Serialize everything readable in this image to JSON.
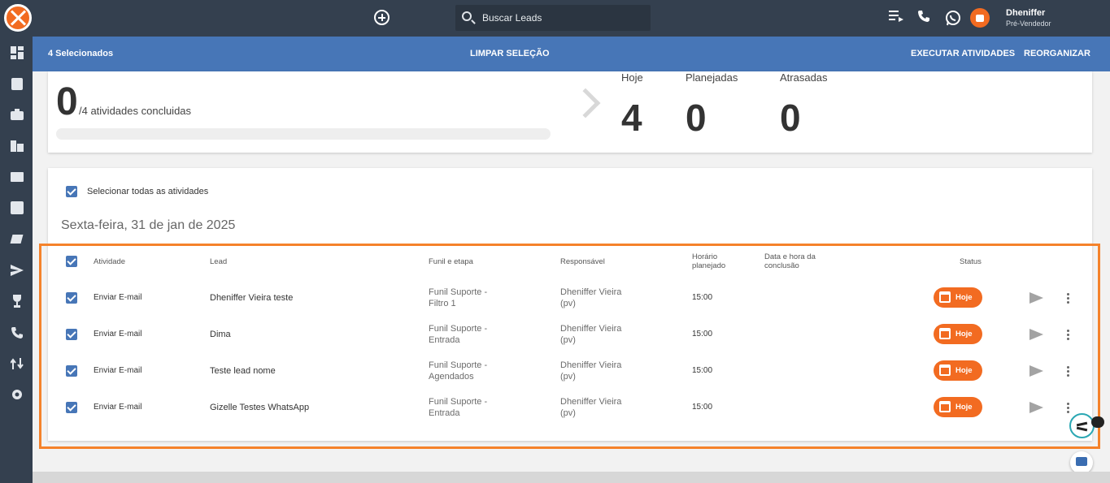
{
  "topbar": {
    "search_placeholder": "Buscar Leads",
    "user_name": "Dheniffer",
    "user_role": "Pré-Vendedor"
  },
  "selection_bar": {
    "selected": "4 Selecionados",
    "clear": "LIMPAR SELEÇÃO",
    "execute": "EXECUTAR ATIVIDADES",
    "reorganize": "REORGANIZAR"
  },
  "summary": {
    "done": "0",
    "done_suffix": "/4 atividades concluidas",
    "progress_fraction": 0,
    "stats": [
      {
        "label": "Hoje",
        "value": "4"
      },
      {
        "label": "Planejadas",
        "value": "0"
      },
      {
        "label": "Atrasadas",
        "value": "0"
      }
    ]
  },
  "activities": {
    "select_all_label": "Selecionar todas as atividades",
    "date_heading": "Sexta-feira, 31 de jan de 2025",
    "headers": {
      "activity": "Atividade",
      "lead": "Lead",
      "funnel": "Funil e etapa",
      "responsible": "Responsável",
      "planned_1": "Horário",
      "planned_2": "planejado",
      "conclusion_1": "Data e hora da",
      "conclusion_2": "conclusão",
      "status": "Status"
    },
    "rows": [
      {
        "activity": "Enviar E-mail",
        "lead": "Dheniffer Vieira teste",
        "funnel_1": "Funil Suporte -",
        "funnel_2": "Filtro 1",
        "resp_1": "Dheniffer Vieira",
        "resp_2": "(pv)",
        "time": "15:00",
        "status": "Hoje"
      },
      {
        "activity": "Enviar E-mail",
        "lead": "Dima",
        "funnel_1": "Funil Suporte -",
        "funnel_2": "Entrada",
        "resp_1": "Dheniffer Vieira",
        "resp_2": "(pv)",
        "time": "15:00",
        "status": "Hoje"
      },
      {
        "activity": "Enviar E-mail",
        "lead": "Teste lead nome",
        "funnel_1": "Funil Suporte -",
        "funnel_2": "Agendados",
        "resp_1": "Dheniffer Vieira",
        "resp_2": "(pv)",
        "time": "15:00",
        "status": "Hoje"
      },
      {
        "activity": "Enviar E-mail",
        "lead": "Gizelle Testes WhatsApp",
        "funnel_1": "Funil Suporte -",
        "funnel_2": "Entrada",
        "resp_1": "Dheniffer Vieira",
        "resp_2": "(pv)",
        "time": "15:00",
        "status": "Hoje"
      }
    ]
  },
  "colors": {
    "topbar": "#34404f",
    "selection_bar": "#4776b7",
    "accent_orange": "#f26b21",
    "highlight_border": "#f5822a"
  },
  "icons": {
    "topbar": [
      "logo",
      "add-icon",
      "search-icon",
      "playlist-icon",
      "phone-icon",
      "whatsapp-icon",
      "avatar"
    ],
    "sidebar": [
      "dashboard-icon",
      "contacts-icon",
      "briefcase-icon",
      "building-icon",
      "mail-icon",
      "chart-icon",
      "tags-icon",
      "send-icon",
      "trophy-icon",
      "phone-icon",
      "flow-icon",
      "settings-icon"
    ]
  }
}
